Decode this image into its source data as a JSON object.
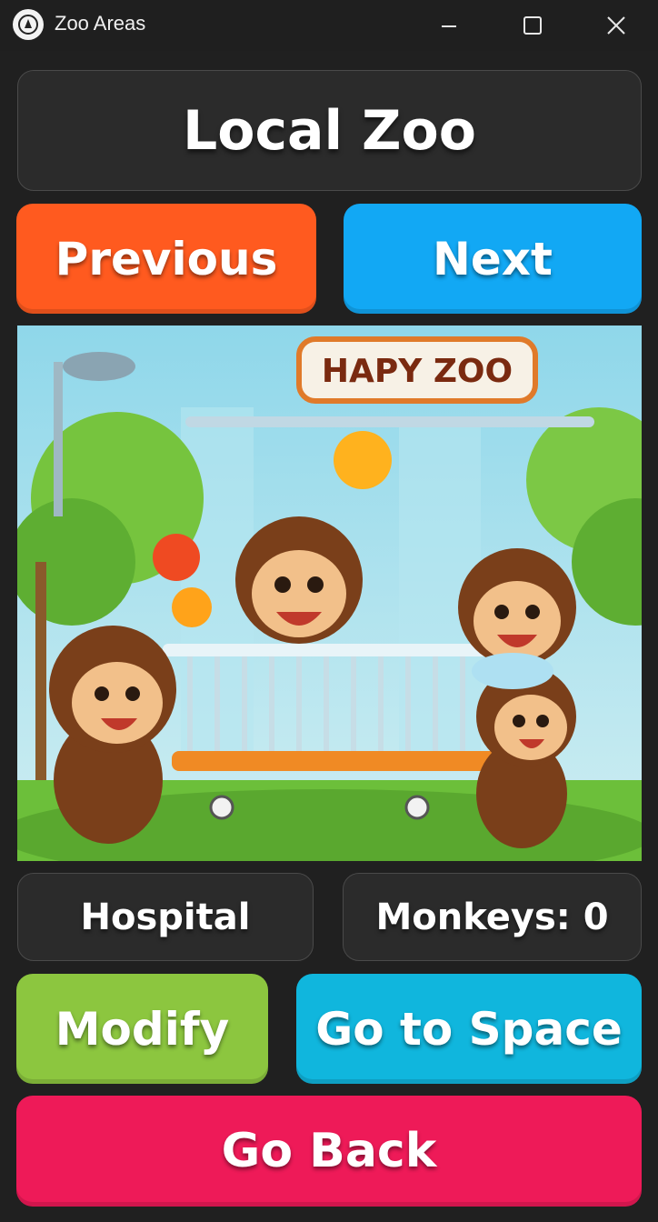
{
  "window": {
    "title": "Zoo Areas"
  },
  "header": {
    "zoo_name": "Local Zoo"
  },
  "nav": {
    "previous_label": "Previous",
    "next_label": "Next"
  },
  "image": {
    "sign_text": "HAPY ZOO"
  },
  "info": {
    "area_name": "Hospital",
    "monkey_count": "Monkeys: 0"
  },
  "actions": {
    "modify_label": "Modify",
    "space_label": "Go to Space",
    "back_label": "Go Back"
  },
  "colors": {
    "previous": "#ff5a1f",
    "next": "#12a8f4",
    "modify": "#8cc63f",
    "space": "#10b6dd",
    "back": "#ee1a58",
    "panel": "#2b2b2b"
  }
}
